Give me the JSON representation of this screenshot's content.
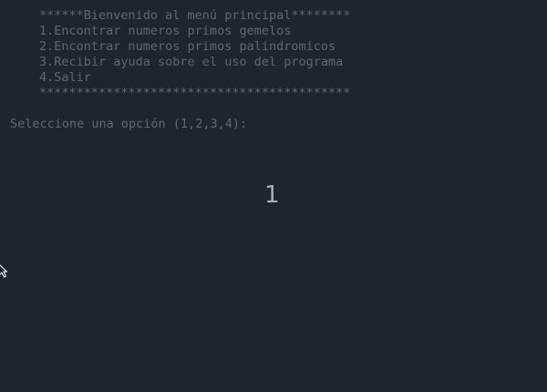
{
  "terminal": {
    "menu": {
      "header": "******Bienvenido al menú principal********",
      "items": [
        "1.Encontrar numeros primos gemelos",
        "2.Encontrar numeros primos palindromicos",
        "3.Recibir ayuda sobre el uso del programa",
        "4.Salir"
      ],
      "footer": "******************************************"
    },
    "prompt": "Seleccione una opción (1,2,3,4):",
    "typed_input": "1"
  },
  "icons": {
    "pointer": "mouse-pointer-icon"
  },
  "colors": {
    "background": "#1f252e",
    "text_dim": "#5f6771",
    "text_bright": "#a7adb4"
  }
}
